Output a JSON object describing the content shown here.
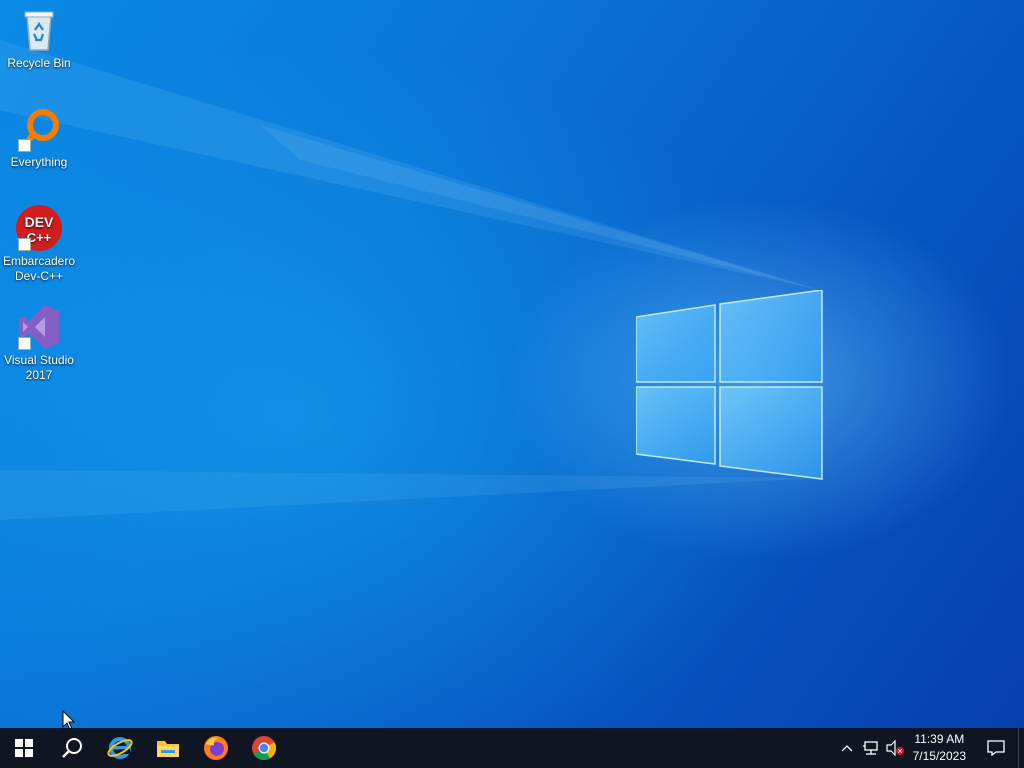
{
  "desktop": {
    "icons": [
      {
        "label": "Recycle Bin",
        "icon": "recycle-bin-icon",
        "shortcut": false
      },
      {
        "label": "Everything",
        "icon": "everything-magnifier-icon",
        "shortcut": true
      },
      {
        "label": "Embarcadero Dev-C++",
        "icon": "dev-cpp-icon",
        "shortcut": true,
        "badge_text": "DEV C++"
      },
      {
        "label": "Visual Studio 2017",
        "icon": "visual-studio-icon",
        "shortcut": true
      }
    ],
    "wallpaper": "windows-10-hero-light"
  },
  "taskbar": {
    "buttons": [
      {
        "name": "start",
        "icon": "windows-start-icon"
      },
      {
        "name": "search",
        "icon": "search-icon"
      },
      {
        "name": "internet-explorer",
        "icon": "internet-explorer-icon"
      },
      {
        "name": "file-explorer",
        "icon": "file-explorer-icon"
      },
      {
        "name": "firefox",
        "icon": "firefox-icon"
      },
      {
        "name": "chrome",
        "icon": "chrome-icon"
      }
    ],
    "tray": {
      "icons": [
        "chevron-up-icon",
        "network-icon",
        "volume-muted-icon"
      ],
      "time": "11:39 AM",
      "date": "7/15/2023"
    }
  },
  "colors": {
    "taskbar": "#0f1622",
    "desktop_accent": "#0a8ae6",
    "everything_orange": "#f57c00",
    "devcpp_red": "#d11d1d",
    "vs_purple": "#865fc5"
  }
}
